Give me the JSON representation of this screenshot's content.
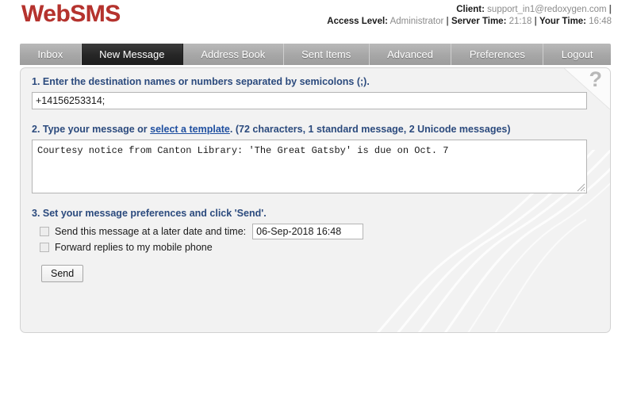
{
  "header": {
    "brand": "WebSMS",
    "session": {
      "client_label": "Client:",
      "client_value": "support_in1@redoxygen.com",
      "access_label": "Access Level:",
      "access_value": "Administrator",
      "server_time_label": "Server Time:",
      "server_time_value": "21:18",
      "your_time_label": "Your Time:",
      "your_time_value": "16:48",
      "separator": "|"
    }
  },
  "tabs": [
    {
      "label": "Inbox",
      "active": false
    },
    {
      "label": "New Message",
      "active": true
    },
    {
      "label": "Address Book",
      "active": false
    },
    {
      "label": "Sent Items",
      "active": false
    },
    {
      "label": "Advanced",
      "active": false
    },
    {
      "label": "Preferences",
      "active": false
    },
    {
      "label": "Logout",
      "active": false
    }
  ],
  "panel": {
    "help_icon": "?",
    "step1": {
      "label": "1. Enter the destination names or numbers separated by semicolons (;).",
      "recipients_value": "+14156253314;",
      "recipients_placeholder": ""
    },
    "step2": {
      "prefix": "2. Type your message or ",
      "link": "select a template",
      "suffix": ". (72 characters, 1 standard message, 2 Unicode messages)",
      "character_count": "72 characters",
      "standard_messages": "1 standard message",
      "unicode_messages": "2 Unicode messages",
      "message_value": "Courtesy notice from Canton Library: 'The Great Gatsby' is due on Oct. 7",
      "message_placeholder": ""
    },
    "step3": {
      "label": "3. Set your message preferences and click 'Send'.",
      "schedule_label": "Send this message at a later date and time:",
      "schedule_checked": false,
      "schedule_value": "06-Sep-2018 16:48",
      "forward_label": "Forward replies to my mobile phone",
      "forward_checked": false,
      "send_label": "Send"
    }
  },
  "colors": {
    "brand": "#b5332e",
    "step_heading": "#2b4a7d",
    "link": "#1f4fa0",
    "active_tab_bg": "#262626",
    "tab_bg": "#a8a8a8",
    "panel_bg": "#f2f2f2"
  }
}
